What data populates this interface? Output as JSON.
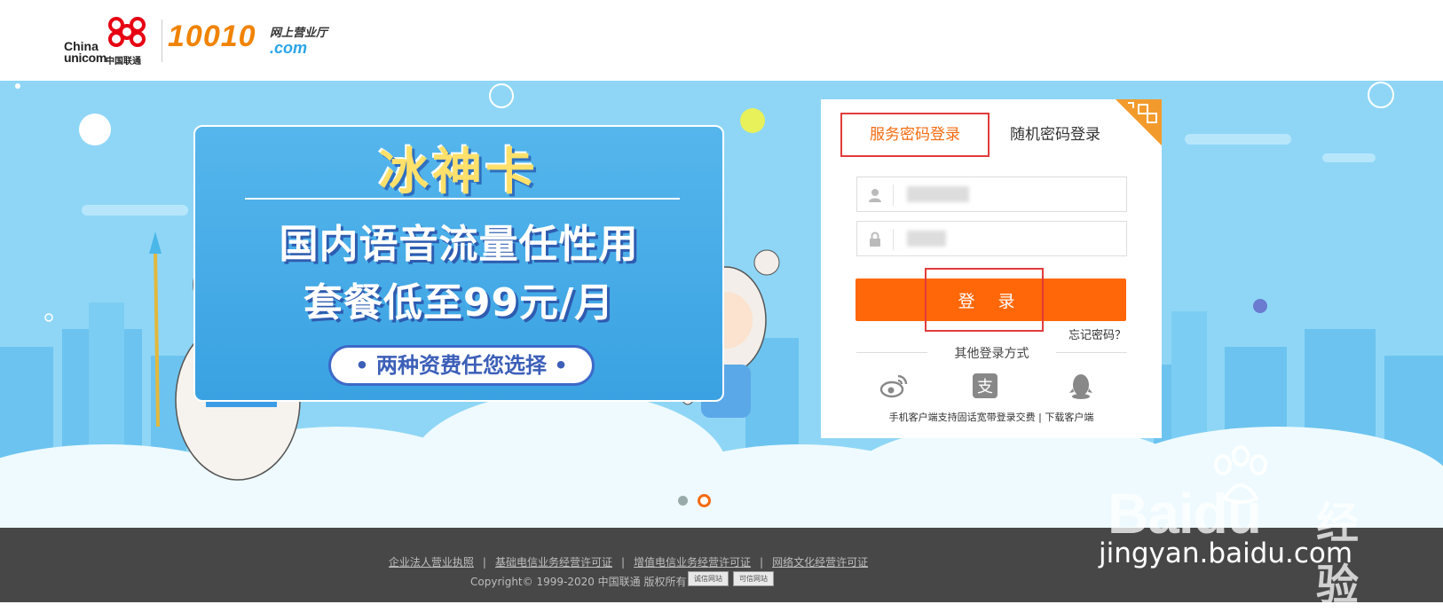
{
  "header": {
    "logo_china": "China",
    "logo_unicom": "unicom",
    "logo_cn": "中国联通",
    "logo_number": "10010",
    "logo_hall": "网上营业厅",
    "logo_com": ".com"
  },
  "banner": {
    "title": "冰神卡",
    "line1": "国内语音流量任性用",
    "line2": "套餐低至99元/月",
    "pill": "• 两种资费任您选择 •",
    "carousel_dots": 2,
    "active_dot": 2
  },
  "login": {
    "tab_service": "服务密码登录",
    "tab_random": "随机密码登录",
    "username_value": "",
    "password_value": "",
    "submit": "登 录",
    "forgot": "忘记密码？",
    "other": "其他登录方式",
    "social": [
      "weibo-icon",
      "alipay-icon",
      "qq-icon"
    ],
    "foot_text": "手机客户端支持固话宽带登录交费",
    "foot_sep": " | ",
    "foot_link": "下载客户端"
  },
  "footer": {
    "links": [
      "企业法人营业执照",
      "基础电信业务经营许可证",
      "增值电信业务经营许可证",
      "网络文化经营许可证"
    ],
    "copyright": "Copyright© 1999-2020 中国联通 版权所有",
    "badge1": "诚信网站",
    "badge2": "可信网站"
  },
  "watermark": {
    "brand": "Bai",
    "brand2": "du",
    "jingyan": "经验",
    "url": "jingyan.baidu.com"
  },
  "colors": {
    "brand_orange": "#ff6708",
    "highlight_red": "#e23b3b",
    "banner_sky": "#8fd6f6",
    "footer_bg": "#474747"
  }
}
